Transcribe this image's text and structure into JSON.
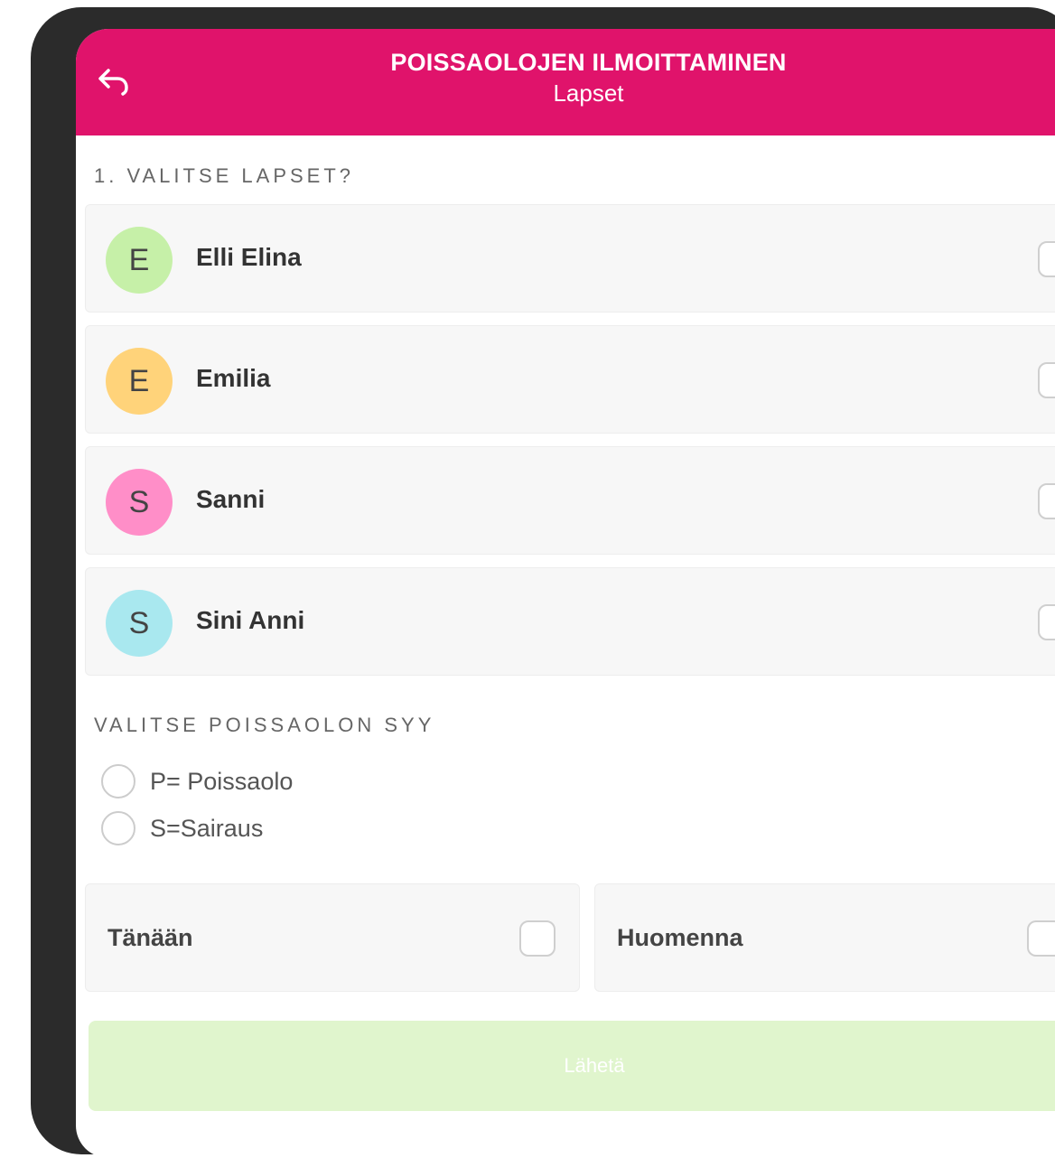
{
  "header": {
    "title": "POISSAOLOJEN ILMOITTAMINEN",
    "subtitle": "Lapset",
    "accent_color": "#e0136b",
    "back_icon": "back-arrow-icon",
    "menu_icon": "hamburger-menu-icon"
  },
  "children_section": {
    "label": "1. VALITSE LAPSET?",
    "children": [
      {
        "initial": "E",
        "name": "Elli Elina",
        "avatar_color": "#c6f0a8",
        "checked": false
      },
      {
        "initial": "E",
        "name": "Emilia",
        "avatar_color": "#ffd37a",
        "checked": false
      },
      {
        "initial": "S",
        "name": "Sanni",
        "avatar_color": "#ff8ec8",
        "checked": false
      },
      {
        "initial": "S",
        "name": "Sini Anni",
        "avatar_color": "#a9e8ef",
        "checked": false
      }
    ]
  },
  "reason_section": {
    "label": "VALITSE POISSAOLON SYY",
    "options": [
      {
        "label": "P= Poissaolo",
        "selected": false
      },
      {
        "label": "S=Sairaus",
        "selected": false
      }
    ]
  },
  "days": {
    "today": {
      "label": "Tänään",
      "checked": false
    },
    "tomorrow": {
      "label": "Huomenna",
      "checked": false
    }
  },
  "send_button": {
    "label": "Lähetä",
    "color": "#e0f5cd"
  }
}
